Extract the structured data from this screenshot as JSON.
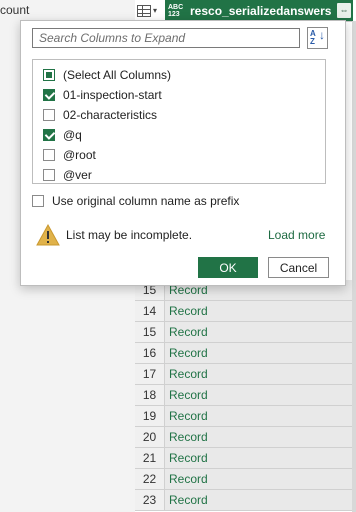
{
  "left_panel": {
    "label": "count"
  },
  "column": {
    "type_badge_top": "ABC",
    "type_badge_bottom": "123",
    "name": "resco_serializedanswers",
    "header_color": "#217346"
  },
  "rows": [
    {
      "num": "15",
      "value": "Record"
    },
    {
      "num": "14",
      "value": "Record"
    },
    {
      "num": "15",
      "value": "Record"
    },
    {
      "num": "16",
      "value": "Record"
    },
    {
      "num": "17",
      "value": "Record"
    },
    {
      "num": "18",
      "value": "Record"
    },
    {
      "num": "19",
      "value": "Record"
    },
    {
      "num": "20",
      "value": "Record"
    },
    {
      "num": "21",
      "value": "Record"
    },
    {
      "num": "22",
      "value": "Record"
    },
    {
      "num": "23",
      "value": "Record"
    }
  ],
  "popup": {
    "search_placeholder": "Search Columns to Expand",
    "sort_icon": "sort-az-icon",
    "items": [
      {
        "label": "(Select All Columns)",
        "state": "partial"
      },
      {
        "label": "01-inspection-start",
        "state": "checked"
      },
      {
        "label": "02-characteristics",
        "state": "unchecked"
      },
      {
        "label": "@q",
        "state": "checked"
      },
      {
        "label": "@root",
        "state": "unchecked"
      },
      {
        "label": "@ver",
        "state": "unchecked"
      }
    ],
    "prefix_label": "Use original column name as prefix",
    "prefix_checked": false,
    "warning_text": "List may be incomplete.",
    "load_more": "Load more",
    "ok_label": "OK",
    "cancel_label": "Cancel"
  }
}
